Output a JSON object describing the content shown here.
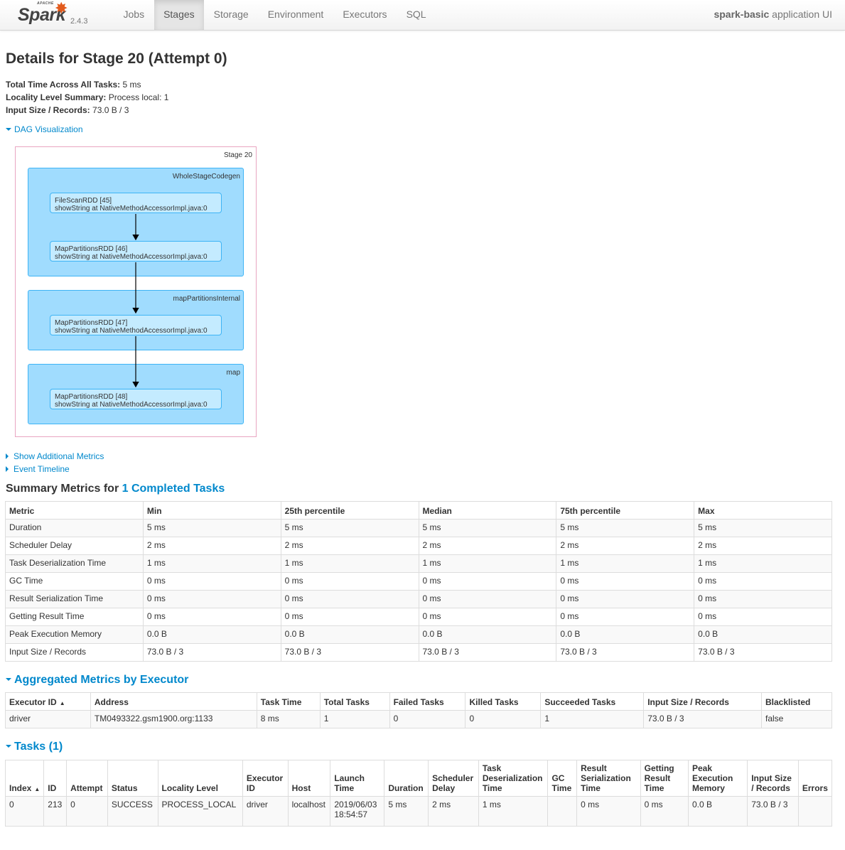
{
  "navbar": {
    "brand_apache": "APACHE",
    "brand_name": "Spark",
    "version": "2.4.3",
    "tabs": [
      "Jobs",
      "Stages",
      "Storage",
      "Environment",
      "Executors",
      "SQL"
    ],
    "active_tab": "Stages",
    "app_name": "spark-basic",
    "app_suffix": " application UI"
  },
  "page": {
    "title": "Details for Stage 20 (Attempt 0)",
    "total_time_label": "Total Time Across All Tasks:",
    "total_time_value": " 5 ms",
    "locality_label": "Locality Level Summary:",
    "locality_value": " Process local: 1",
    "input_label": "Input Size / Records:",
    "input_value": " 73.0 B / 3"
  },
  "dag": {
    "toggle_label": "DAG Visualization",
    "stage_label": "Stage 20",
    "clusters": [
      {
        "label": "WholeStageCodegen",
        "nodes": [
          {
            "line1": "FileScanRDD [45]",
            "line2": "showString at NativeMethodAccessorImpl.java:0"
          },
          {
            "line1": "MapPartitionsRDD [46]",
            "line2": "showString at NativeMethodAccessorImpl.java:0"
          }
        ]
      },
      {
        "label": "mapPartitionsInternal",
        "nodes": [
          {
            "line1": "MapPartitionsRDD [47]",
            "line2": "showString at NativeMethodAccessorImpl.java:0"
          }
        ]
      },
      {
        "label": "map",
        "nodes": [
          {
            "line1": "MapPartitionsRDD [48]",
            "line2": "showString at NativeMethodAccessorImpl.java:0"
          }
        ]
      }
    ]
  },
  "toggles": {
    "additional_metrics": "Show Additional Metrics",
    "event_timeline": "Event Timeline"
  },
  "summary_metrics": {
    "heading_prefix": "Summary Metrics for ",
    "heading_link": "1 Completed Tasks",
    "headers": [
      "Metric",
      "Min",
      "25th percentile",
      "Median",
      "75th percentile",
      "Max"
    ],
    "rows": [
      [
        "Duration",
        "5 ms",
        "5 ms",
        "5 ms",
        "5 ms",
        "5 ms"
      ],
      [
        "Scheduler Delay",
        "2 ms",
        "2 ms",
        "2 ms",
        "2 ms",
        "2 ms"
      ],
      [
        "Task Deserialization Time",
        "1 ms",
        "1 ms",
        "1 ms",
        "1 ms",
        "1 ms"
      ],
      [
        "GC Time",
        "0 ms",
        "0 ms",
        "0 ms",
        "0 ms",
        "0 ms"
      ],
      [
        "Result Serialization Time",
        "0 ms",
        "0 ms",
        "0 ms",
        "0 ms",
        "0 ms"
      ],
      [
        "Getting Result Time",
        "0 ms",
        "0 ms",
        "0 ms",
        "0 ms",
        "0 ms"
      ],
      [
        "Peak Execution Memory",
        "0.0 B",
        "0.0 B",
        "0.0 B",
        "0.0 B",
        "0.0 B"
      ],
      [
        "Input Size / Records",
        "73.0 B / 3",
        "73.0 B / 3",
        "73.0 B / 3",
        "73.0 B / 3",
        "73.0 B / 3"
      ]
    ]
  },
  "executor_metrics": {
    "heading": "Aggregated Metrics by Executor",
    "headers": [
      "Executor ID",
      "Address",
      "Task Time",
      "Total Tasks",
      "Failed Tasks",
      "Killed Tasks",
      "Succeeded Tasks",
      "Input Size / Records",
      "Blacklisted"
    ],
    "rows": [
      [
        "driver",
        "TM0493322.gsm1900.org:1133",
        "8 ms",
        "1",
        "0",
        "0",
        "1",
        "73.0 B / 3",
        "false"
      ]
    ]
  },
  "tasks": {
    "heading": "Tasks (1)",
    "headers": [
      "Index",
      "ID",
      "Attempt",
      "Status",
      "Locality Level",
      "Executor ID",
      "Host",
      "Launch Time",
      "Duration",
      "Scheduler Delay",
      "Task Deserialization Time",
      "GC Time",
      "Result Serialization Time",
      "Getting Result Time",
      "Peak Execution Memory",
      "Input Size / Records",
      "Errors"
    ],
    "rows": [
      [
        "0",
        "213",
        "0",
        "SUCCESS",
        "PROCESS_LOCAL",
        "driver",
        "localhost",
        "2019/06/03 18:54:57",
        "5 ms",
        "2 ms",
        "1 ms",
        "",
        "0 ms",
        "0 ms",
        "0.0 B",
        "73.0 B / 3",
        ""
      ]
    ]
  }
}
